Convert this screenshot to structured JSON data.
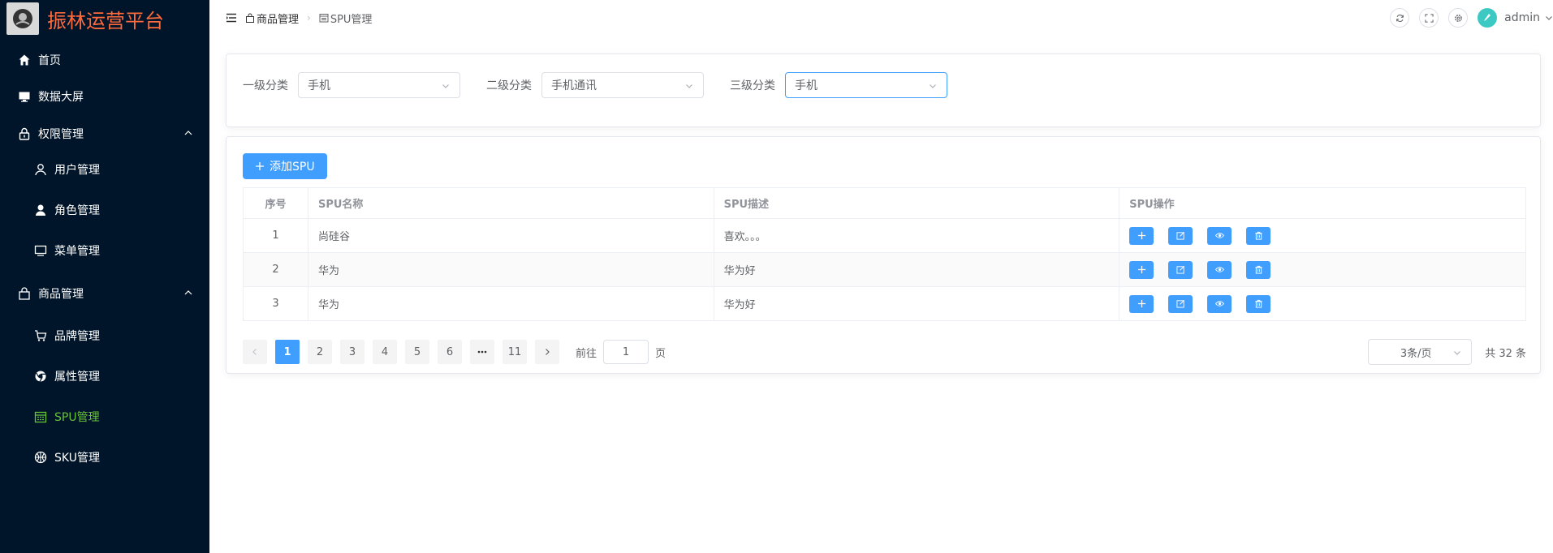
{
  "app": {
    "title": "振林运营平台"
  },
  "sidebar": {
    "items": [
      {
        "label": "首页",
        "icon": "home-icon"
      },
      {
        "label": "数据大屏",
        "icon": "monitor-icon"
      },
      {
        "label": "权限管理",
        "icon": "lock-icon",
        "expanded": true
      },
      {
        "label": "用户管理",
        "icon": "user-icon"
      },
      {
        "label": "角色管理",
        "icon": "user-filled-icon"
      },
      {
        "label": "菜单管理",
        "icon": "monitor-icon"
      },
      {
        "label": "商品管理",
        "icon": "shopping-bag-icon",
        "expanded": true
      },
      {
        "label": "品牌管理",
        "icon": "shopping-cart-icon"
      },
      {
        "label": "属性管理",
        "icon": "chrome-icon"
      },
      {
        "label": "SPU管理",
        "icon": "calendar-icon",
        "active": true
      },
      {
        "label": "SKU管理",
        "icon": "basketball-icon"
      }
    ]
  },
  "header": {
    "breadcrumb": [
      "商品管理",
      "SPU管理"
    ],
    "username": "admin"
  },
  "filters": [
    {
      "label": "一级分类",
      "value": "手机"
    },
    {
      "label": "二级分类",
      "value": "手机通讯"
    },
    {
      "label": "三级分类",
      "value": "手机"
    }
  ],
  "spu": {
    "add_label": "添加SPU",
    "columns": [
      "序号",
      "SPU名称",
      "SPU描述",
      "SPU操作"
    ],
    "rows": [
      {
        "index": "1",
        "name": "尚硅谷",
        "desc": "喜欢。。。"
      },
      {
        "index": "2",
        "name": "华为",
        "desc": "华为好"
      },
      {
        "index": "3",
        "name": "华为",
        "desc": "华为好"
      }
    ]
  },
  "pagination": {
    "pages": [
      "1",
      "2",
      "3",
      "4",
      "5",
      "6",
      "11"
    ],
    "current": "1",
    "jump_prefix": "前往",
    "jump_value": "1",
    "jump_suffix": "页",
    "page_size": "3条/页",
    "total": "共 32 条"
  },
  "colors": {
    "sidebar_bg": "#001529",
    "primary": "#409eff",
    "active_menu": "#67c23a",
    "title": "#ff6a3d"
  }
}
